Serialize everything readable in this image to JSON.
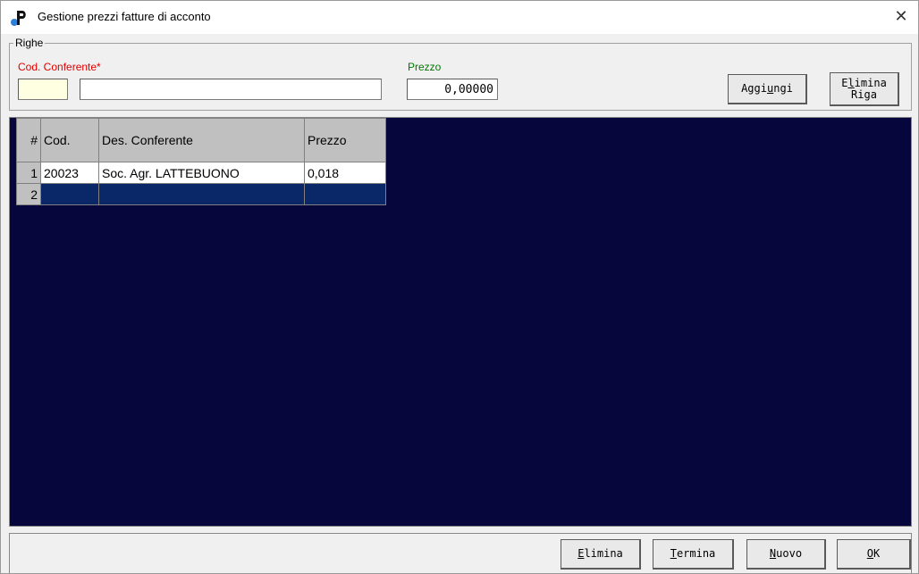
{
  "window": {
    "title": "Gestione prezzi fatture di acconto",
    "close_glyph": "✕",
    "app_icon": "app-logo-icon"
  },
  "group": {
    "legend": "Righe",
    "code_label": "Cod. Conferente*",
    "price_label": "Prezzo",
    "code_value": "",
    "desc_value": "",
    "price_value": "0,00000",
    "add_button": {
      "pre": "Aggi",
      "key": "u",
      "post": "ngi"
    },
    "delete_row_button": {
      "line1_pre": "E",
      "line1_key": "l",
      "line1_post": "imina",
      "line2": "Riga"
    }
  },
  "grid": {
    "headers": [
      "#",
      "Cod.",
      "Des. Conferente",
      "Prezzo"
    ],
    "rows": [
      {
        "num": "1",
        "cod": "20023",
        "des": "Soc. Agr. LATTEBUONO",
        "prezzo": "0,018"
      },
      {
        "num": "2",
        "cod": "",
        "des": "",
        "prezzo": ""
      }
    ]
  },
  "footer": {
    "elimina": {
      "key": "E",
      "rest": "limina"
    },
    "termina": {
      "key": "T",
      "rest": "ermina"
    },
    "nuovo": {
      "key": "N",
      "rest": "uovo"
    },
    "ok": {
      "key": "O",
      "rest": "K"
    }
  },
  "colors": {
    "required_label": "#e00000",
    "price_label": "#007a00",
    "grid_background": "#06063d",
    "selected_row": "#0a2868",
    "code_field_bg": "#ffffe1"
  }
}
